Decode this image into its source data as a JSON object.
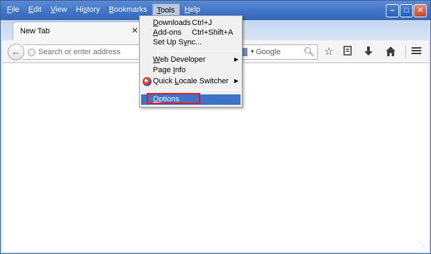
{
  "menubar": {
    "items": [
      {
        "pre": "",
        "acc": "F",
        "post": "ile"
      },
      {
        "pre": "",
        "acc": "E",
        "post": "dit"
      },
      {
        "pre": "",
        "acc": "V",
        "post": "iew"
      },
      {
        "pre": "Hi",
        "acc": "s",
        "post": "tory"
      },
      {
        "pre": "",
        "acc": "B",
        "post": "ookmarks"
      },
      {
        "pre": "",
        "acc": "T",
        "post": "ools"
      },
      {
        "pre": "",
        "acc": "H",
        "post": "elp"
      }
    ]
  },
  "window_buttons": {
    "minimize": "–",
    "maximize": "□",
    "close": "✕"
  },
  "tab": {
    "label": "New Tab",
    "close": "✕"
  },
  "navbar": {
    "url_placeholder": "Search or enter address",
    "search_placeholder": "Google",
    "icons": [
      "back-arrow-icon",
      "star-icon",
      "bookmarks-list-icon",
      "downloads-icon",
      "home-icon",
      "menu-icon"
    ]
  },
  "tools_menu": {
    "downloads": {
      "pre": "",
      "acc": "D",
      "post": "ownloads",
      "shortcut": "Ctrl+J"
    },
    "addons": {
      "pre": "",
      "acc": "A",
      "post": "dd-ons",
      "shortcut": "Ctrl+Shift+A"
    },
    "setup_sync": {
      "pre": "Set Up S",
      "acc": "y",
      "post": "nc..."
    },
    "web_developer": {
      "pre": "",
      "acc": "W",
      "post": "eb Developer"
    },
    "page_info": {
      "pre": "Page ",
      "acc": "I",
      "post": "nfo"
    },
    "quick_locale": {
      "pre": "Quick ",
      "acc": "L",
      "post": "ocale Switcher"
    },
    "options": {
      "pre": "",
      "acc": "O",
      "post": "ptions"
    }
  },
  "colors": {
    "highlight_box": "#e01b1b",
    "menu_highlight": "#3d74c9"
  }
}
